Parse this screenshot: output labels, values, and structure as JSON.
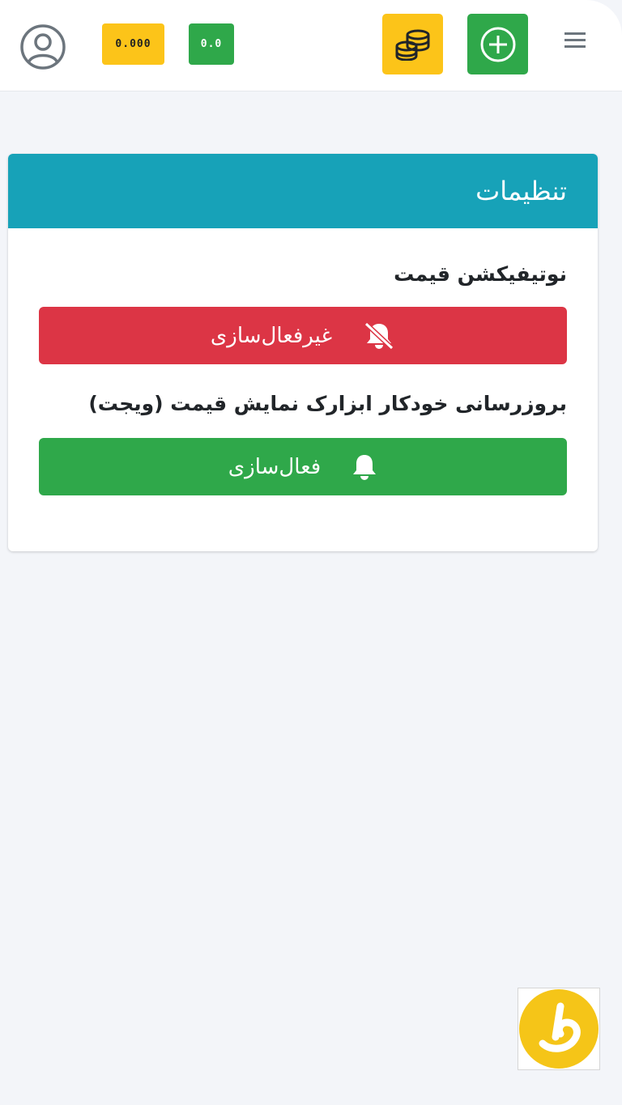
{
  "header": {
    "coins_count_badge": "0.000",
    "balance_badge": "0.0",
    "icons": {
      "avatar": "user-circle-icon",
      "coins": "coins-stack-icon",
      "add": "plus-circle-icon",
      "menu": "hamburger-menu-icon"
    }
  },
  "settings": {
    "title": "تنظیمات",
    "price_notification": {
      "label": "نوتیفیکشن قیمت",
      "button_label": "غیرفعال‌سازی",
      "icon": "bell-off-icon",
      "color": "#dc3545"
    },
    "widget_update": {
      "label": "بروزرسانی خودکار ابزارک نمایش قیمت (ویجت)",
      "button_label": "فعال‌سازی",
      "icon": "bell-icon",
      "color": "#2fa84a"
    }
  },
  "colors": {
    "header_accent": "#17a2b8",
    "yellow": "#fcc419",
    "green": "#2fa84a",
    "red": "#dc3545",
    "background": "#f3f5f9"
  },
  "brand": {
    "logo_icon": "brand-logo-icon"
  }
}
